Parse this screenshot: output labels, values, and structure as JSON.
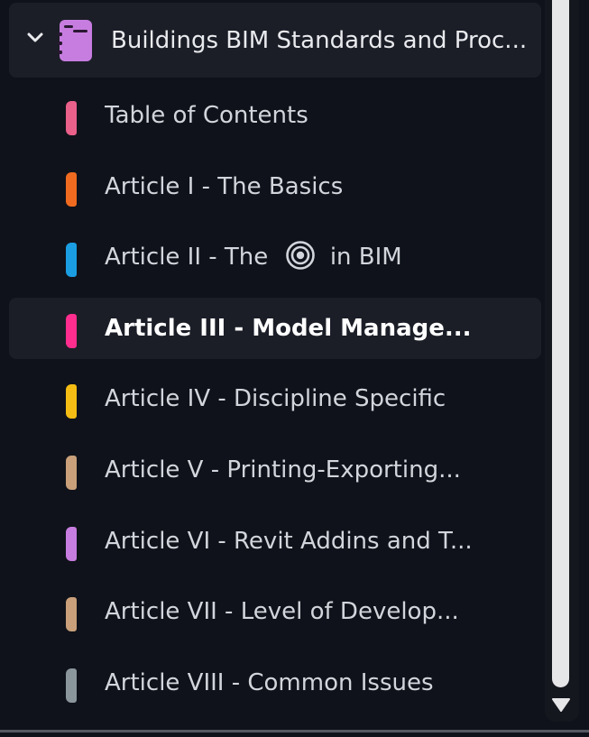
{
  "notebook": {
    "title": "Buildings BIM Standards and Proc...",
    "expanded": true,
    "icon": "notebook-icon",
    "icon_color": "#c77ddf"
  },
  "sections": [
    {
      "label": "Table of Contents",
      "color": "#e9608a",
      "selected": false
    },
    {
      "label": "Article I - The Basics",
      "color": "#f06b1f",
      "selected": false
    },
    {
      "label_before": "Article II - The",
      "icon": "target-eye-icon",
      "label_after": "in BIM",
      "color": "#1b9de2",
      "selected": false
    },
    {
      "label": "Article III - Model Manage...",
      "color": "#ff2e8e",
      "selected": true
    },
    {
      "label": "Article IV - Discipline Specific",
      "color": "#f5bd13",
      "selected": false
    },
    {
      "label": "Article V - Printing-Exporting...",
      "color": "#c9a07a",
      "selected": false
    },
    {
      "label": "Article VI - Revit Addins and T...",
      "color": "#c77ddf",
      "selected": false
    },
    {
      "label": "Article VII - Level of Develop...",
      "color": "#c9a07a",
      "selected": false
    },
    {
      "label": "Article VIII - Common Issues",
      "color": "#8a969b",
      "selected": false
    }
  ],
  "scrollbar": {
    "down_arrow_icon": "triangle-down-icon"
  }
}
